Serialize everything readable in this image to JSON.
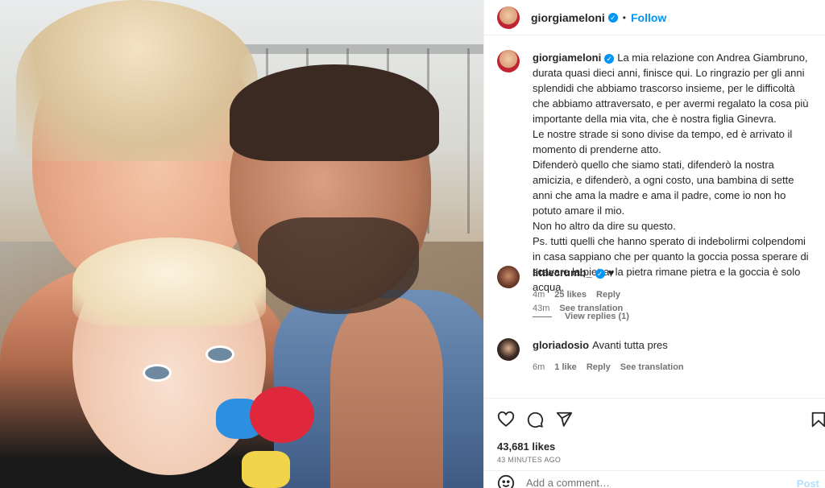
{
  "post": {
    "author": "giorgiameloni",
    "follow_label": "Follow",
    "separator": "•"
  },
  "caption": {
    "username": "giorgiameloni",
    "text": "La mia relazione con Andrea Giambruno, durata quasi dieci anni, finisce qui. Lo ringrazio per gli anni splendidi che abbiamo trascorso insieme, per le difficoltà che abbiamo attraversato, e per avermi regalato la cosa più importante della mia vita, che è nostra figlia Ginevra.\nLe nostre strade si sono divise da tempo, ed è arrivato il momento di prenderne atto.\nDifenderò quello che siamo stati, difenderò la nostra amicizia, e difenderò, a ogni costo, una bambina di sette anni che ama la madre e ama il padre, come io non ho potuto amare il mio.\nNon ho altro da dire su questo.\nPs. tutti quelli che hanno sperato di indebolirmi colpendomi in casa sappiano che per quanto la goccia possa sperare di scavare la pietra, la pietra rimane pietra e la goccia è solo acqua.",
    "time": "43m",
    "see_translation": "See translation"
  },
  "comments": [
    {
      "username": "littlecrumb_",
      "text": "♥",
      "time": "4m",
      "likes": "25 likes",
      "reply": "Reply",
      "view_replies": "View replies (1)"
    },
    {
      "username": "gloriadosio",
      "text": "Avanti tutta pres",
      "time": "6m",
      "likes": "1 like",
      "reply": "Reply",
      "see_translation": "See translation"
    }
  ],
  "stats": {
    "likes": "43,681 likes",
    "time_ago": "43 MINUTES AGO"
  },
  "composer": {
    "placeholder": "Add a comment…",
    "post_label": "Post"
  },
  "icons": {
    "like": "heart-icon",
    "comment": "comment-icon",
    "share": "share-icon",
    "save": "bookmark-icon",
    "emoji": "emoji-icon",
    "verified": "verified-icon"
  },
  "colors": {
    "accent": "#0095f6",
    "text": "#262626",
    "muted": "#737373"
  }
}
